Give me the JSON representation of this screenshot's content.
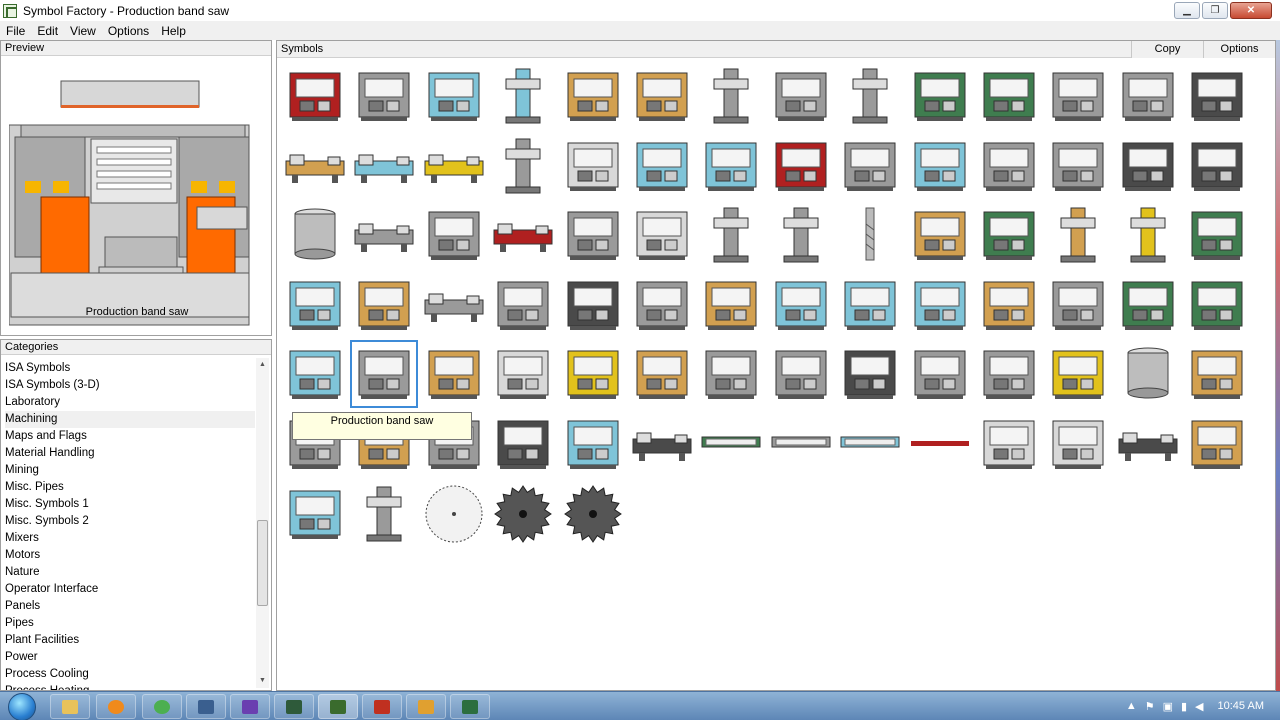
{
  "window": {
    "title": "Symbol Factory - Production band saw"
  },
  "menu": [
    "File",
    "Edit",
    "View",
    "Options",
    "Help"
  ],
  "preview": {
    "header": "Preview",
    "caption": "Production band saw"
  },
  "categories": {
    "header": "Categories",
    "items": [
      "ISA Symbols",
      "ISA Symbols (3-D)",
      "Laboratory",
      "Machining",
      "Maps and Flags",
      "Material Handling",
      "Mining",
      "Misc. Pipes",
      "Misc. Symbols 1",
      "Misc. Symbols 2",
      "Mixers",
      "Motors",
      "Nature",
      "Operator Interface",
      "Panels",
      "Pipes",
      "Plant Facilities",
      "Power",
      "Process Cooling",
      "Process Heating"
    ],
    "selected": "Machining"
  },
  "symbols": {
    "header": "Symbols",
    "copy_label": "Copy",
    "options_label": "Options",
    "tooltip": "Production band saw",
    "selected_index": 57,
    "colors": {
      "gray": "#9a9a9a",
      "blue": "#7fc4d8",
      "green": "#3f7d4f",
      "yellow": "#e2c21c",
      "tan": "#d2a050",
      "red": "#b02020",
      "lightgray": "#d8d8d8",
      "darkgray": "#4a4a4a"
    },
    "icons": [
      "press-red",
      "press-frame",
      "press-blue",
      "drill-teal",
      "press-tan",
      "press-orange",
      "press-column",
      "press-gray",
      "press-vertical",
      "press-green",
      "press-green-wide",
      "press-gray-wide",
      "press-pink",
      "press-dark",
      "lathe-tan",
      "lathe-blue",
      "lathe-yellow",
      "drill-column",
      "cnc-white",
      "cnc-teal",
      "cnc-blue",
      "cnc-red",
      "mill-gray",
      "grinder-blue",
      "machine-gray",
      "grinder-gray",
      "machine-dark",
      "machine-darkgray",
      "tank-gray",
      "lathe-small",
      "cnc-purple",
      "lathe-red",
      "cnc-gray",
      "mill-white",
      "radial-drill",
      "radial-drill-2",
      "drill-bit",
      "saw-tan",
      "machine-green",
      "drill-stand",
      "drill-yellow",
      "machine-green-2",
      "tumbler-blue",
      "machine-tan",
      "lathe-gray",
      "cnc-gray-2",
      "cnc-dark",
      "bench-gray",
      "cabinet-orange",
      "cnc-teal-2",
      "cnc-teal-3",
      "cnc-teal-4",
      "cnc-tan",
      "cnc-large",
      "cnc-green",
      "cnc-green-2",
      "machine-blue",
      "band-saw",
      "machine-beige",
      "tower-white",
      "press-yellow",
      "machine-tan-2",
      "cmm-gray",
      "cmm-small",
      "cmm-black",
      "control-panel",
      "machine-gray-2",
      "cmm-yellow",
      "tank-rough",
      "bench-tan",
      "machine-gray-3",
      "cabinet-beige",
      "tool-gray",
      "shear-dark",
      "machine-teal",
      "lathe-dark",
      "conveyor-green",
      "conveyor-gray",
      "tripod-teal",
      "bar-red",
      "monitor-white",
      "cmm-white",
      "lathe-black",
      "cabinet-tan",
      "machine-blue-2",
      "press-small",
      "saw-blade",
      "gear-1",
      "gear-2"
    ]
  },
  "taskbar": {
    "clock": "10:45 AM"
  }
}
